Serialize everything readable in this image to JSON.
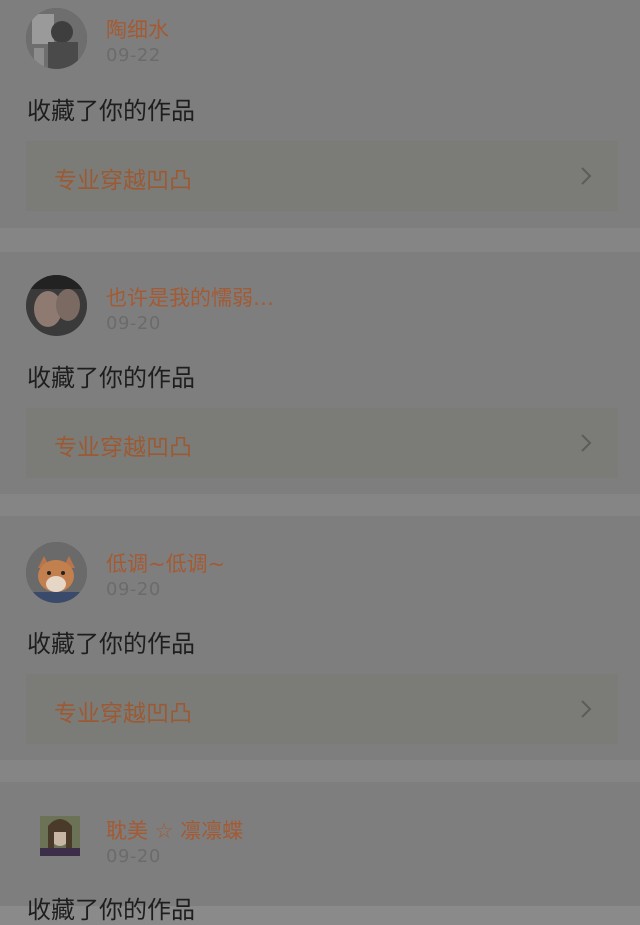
{
  "feed": {
    "items": [
      {
        "username": "陶细水",
        "date": "09-22",
        "action": "收藏了你的作品",
        "work_title": "专业穿越凹凸",
        "avatar_icon": "avatar-photo-person"
      },
      {
        "username": "也许是我的懦弱…",
        "date": "09-20",
        "action": "收藏了你的作品",
        "work_title": "专业穿越凹凸",
        "avatar_icon": "avatar-photo-couple"
      },
      {
        "username": "低调~低调~",
        "date": "09-20",
        "action": "收藏了你的作品",
        "work_title": "专业穿越凹凸",
        "avatar_icon": "avatar-photo-shiba"
      },
      {
        "username": "耽美 ☆ 凛凛蝶",
        "date": "09-20",
        "action": "收藏了你的作品",
        "work_title": "",
        "avatar_icon": "avatar-photo-girl"
      }
    ]
  },
  "colors": {
    "username": "#a45a33",
    "work_title": "#9b5a34",
    "card_background": "#7e7e7e",
    "link_background": "#7b7c78"
  }
}
